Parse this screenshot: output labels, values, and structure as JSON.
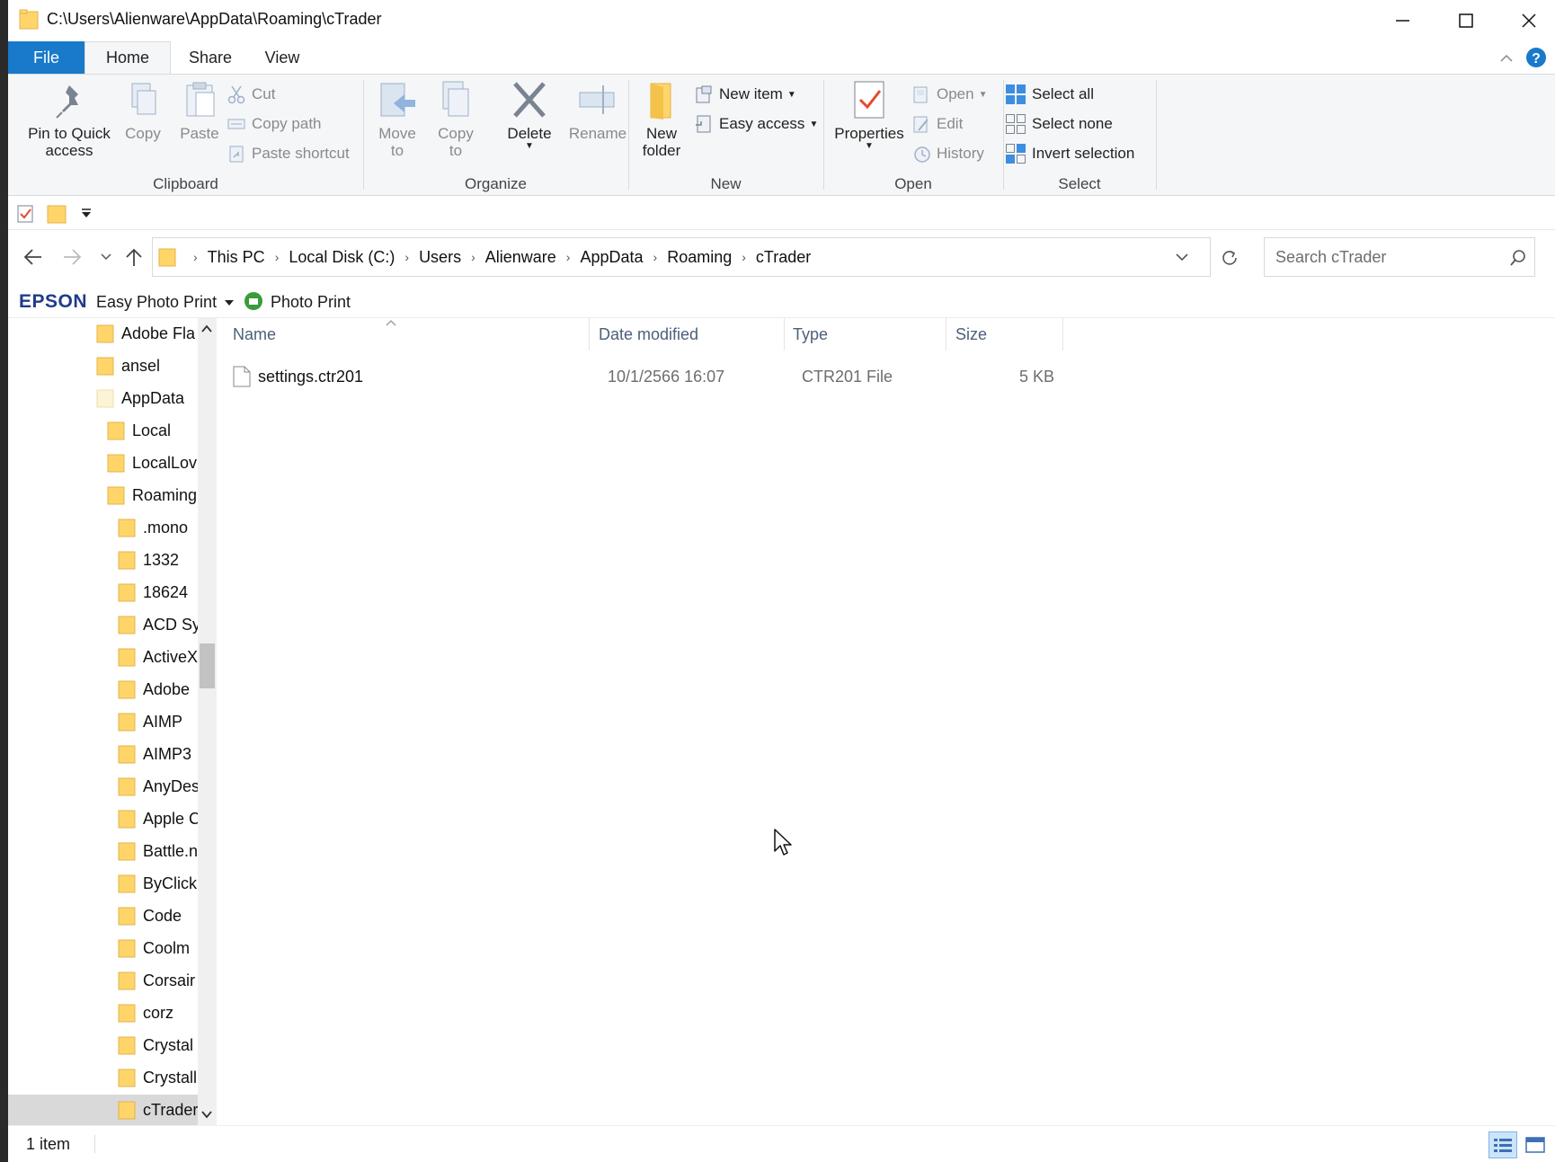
{
  "window": {
    "title": "C:\\Users\\Alienware\\AppData\\Roaming\\cTrader",
    "controls": [
      "minimize-icon",
      "maximize-icon",
      "close-icon"
    ]
  },
  "tabs": [
    "File",
    "Home",
    "Share",
    "View"
  ],
  "ribbon": {
    "clipboard": {
      "label": "Clipboard",
      "pin_line1": "Pin to Quick",
      "pin_line2": "access",
      "copy": "Copy",
      "paste": "Paste",
      "cut": "Cut",
      "copy_path": "Copy path",
      "paste_shortcut": "Paste shortcut"
    },
    "organize": {
      "label": "Organize",
      "move_line1": "Move",
      "move_line2": "to",
      "copy_line1": "Copy",
      "copy_line2": "to",
      "delete": "Delete",
      "rename": "Rename"
    },
    "new": {
      "label": "New",
      "new_folder_line1": "New",
      "new_folder_line2": "folder",
      "new_item": "New item",
      "easy_access": "Easy access"
    },
    "open": {
      "label": "Open",
      "properties": "Properties",
      "open": "Open",
      "edit": "Edit",
      "history": "History"
    },
    "select": {
      "label": "Select",
      "select_all": "Select all",
      "select_none": "Select none",
      "invert_selection": "Invert selection"
    }
  },
  "address": {
    "crumbs": [
      "This PC",
      "Local Disk (C:)",
      "Users",
      "Alienware",
      "AppData",
      "Roaming",
      "cTrader"
    ],
    "search_placeholder": "Search cTrader"
  },
  "epson": {
    "brand": "EPSON",
    "easy_photo_print": "Easy Photo Print",
    "photo_print": "Photo Print"
  },
  "nav_tree": [
    "Adobe Fla",
    "ansel",
    "AppData",
    "Local",
    "LocalLov",
    "Roaming",
    ".mono",
    "1332",
    "18624",
    "ACD Sy",
    "ActiveX",
    "Adobe",
    "AIMP",
    "AIMP3",
    "AnyDes",
    "Apple C",
    "Battle.n",
    "ByClick",
    "Code",
    "Coolm",
    "Corsair",
    "corz",
    "Crystal",
    "Crystall",
    "cTrader"
  ],
  "columns": {
    "name": "Name",
    "date": "Date modified",
    "type": "Type",
    "size": "Size"
  },
  "files": [
    {
      "name": "settings.ctr201",
      "date": "10/1/2566 16:07",
      "type": "CTR201 File",
      "size": "5 KB"
    }
  ],
  "status": {
    "count": "1 item"
  },
  "colors": {
    "file_tab": "#1979ca",
    "ribbon_bg": "#f5f6f7",
    "header_text": "#4c607a",
    "folder": "#ffd56a",
    "selection": "#d9d9d9"
  }
}
